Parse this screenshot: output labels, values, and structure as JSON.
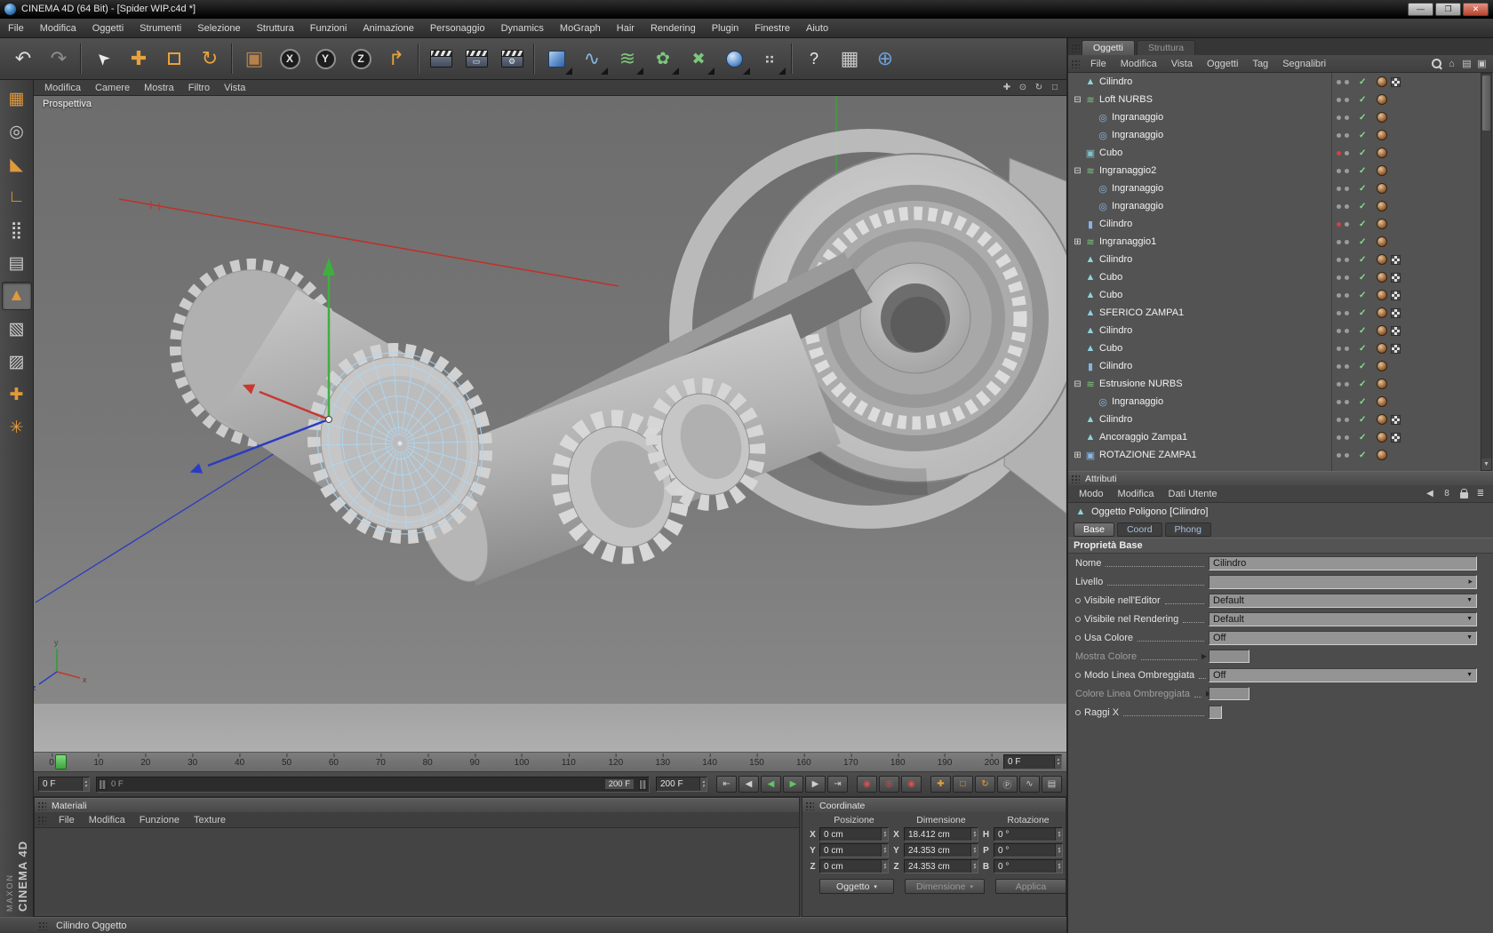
{
  "window": {
    "title": "CINEMA 4D (64 Bit) - [Spider WIP.c4d *]",
    "controls": {
      "minimize": "—",
      "restore": "❐",
      "close": "✕"
    }
  },
  "menu_bar": [
    "File",
    "Modifica",
    "Oggetti",
    "Strumenti",
    "Selezione",
    "Struttura",
    "Funzioni",
    "Animazione",
    "Personaggio",
    "Dynamics",
    "MoGraph",
    "Hair",
    "Rendering",
    "Plugin",
    "Finestre",
    "Aiuto"
  ],
  "toolbar": [
    {
      "name": "undo-button",
      "type": "glyph",
      "glyph": "↶",
      "color": "#dcdcdc"
    },
    {
      "name": "redo-button",
      "type": "glyph",
      "glyph": "↷",
      "color": "#8d8d8d"
    },
    {
      "name": "sep"
    },
    {
      "name": "live-selection-tool",
      "type": "glyph",
      "glyph": "➤",
      "color": "#ececec",
      "rotate": -135,
      "size": 18
    },
    {
      "name": "move-tool",
      "type": "glyph",
      "glyph": "✚",
      "color": "#e8a23c"
    },
    {
      "name": "scale-tool",
      "type": "square"
    },
    {
      "name": "rotate-tool",
      "type": "glyph",
      "glyph": "↻",
      "color": "#e8a23c"
    },
    {
      "name": "sep"
    },
    {
      "name": "coordinate-box-tool",
      "type": "glyph",
      "glyph": "▣",
      "color": "#b5824c"
    },
    {
      "name": "x-axis-lock",
      "type": "xyz",
      "letter": "X"
    },
    {
      "name": "y-axis-lock",
      "type": "xyz",
      "letter": "Y"
    },
    {
      "name": "z-axis-lock",
      "type": "xyz",
      "letter": "Z"
    },
    {
      "name": "coordinate-system-toggle",
      "type": "glyph",
      "glyph": "↱",
      "color": "#e8a23c"
    },
    {
      "name": "sep"
    },
    {
      "name": "render-view-button",
      "type": "clapper",
      "overlay": ""
    },
    {
      "name": "render-picture-viewer-button",
      "type": "clapper",
      "overlay": "▭"
    },
    {
      "name": "render-settings-button",
      "type": "clapper",
      "overlay": "⚙"
    },
    {
      "name": "sep"
    },
    {
      "name": "add-cube-button",
      "type": "cube",
      "dropdown": true
    },
    {
      "name": "add-spline-button",
      "type": "glyph",
      "glyph": "∿",
      "color": "#8ab4e0",
      "dropdown": true
    },
    {
      "name": "add-nurbs-button",
      "type": "glyph",
      "glyph": "≋",
      "color": "#7cc87c",
      "dropdown": true
    },
    {
      "name": "add-modeling-button",
      "type": "glyph",
      "glyph": "✿",
      "color": "#7cc87c",
      "dropdown": true,
      "size": 19
    },
    {
      "name": "add-deformer-button",
      "type": "glyph",
      "glyph": "✖",
      "color": "#7cc87c",
      "dropdown": true,
      "size": 18
    },
    {
      "name": "add-scene-button",
      "type": "sphere",
      "dropdown": true
    },
    {
      "name": "add-particle-button",
      "type": "glyph",
      "glyph": "⠶",
      "color": "#c8c8c8",
      "dropdown": true,
      "size": 18
    },
    {
      "name": "sep"
    },
    {
      "name": "help-button",
      "type": "glyph",
      "glyph": "?",
      "color": "#ececec",
      "size": 18
    },
    {
      "name": "content-browser-button",
      "type": "glyph",
      "glyph": "▦",
      "color": "#c8c8c8"
    },
    {
      "name": "online-updater-button",
      "type": "glyph",
      "glyph": "⊕",
      "color": "#6f9fd8"
    }
  ],
  "left_toolbar": [
    {
      "name": "make-editable-button",
      "glyph": "▦",
      "color": "#e0993c"
    },
    {
      "name": "model-mode-button",
      "glyph": "◎",
      "color": "#c8c8c8"
    },
    {
      "name": "texture-mode-button",
      "glyph": "◣",
      "color": "#e0993c"
    },
    {
      "name": "workplane-mode-button",
      "glyph": "∟",
      "color": "#e0993c"
    },
    {
      "name": "points-mode-button",
      "glyph": "⣿",
      "color": "#d0d0d0"
    },
    {
      "name": "edges-mode-button",
      "glyph": "▤",
      "color": "#d0d0d0"
    },
    {
      "name": "polygons-mode-button",
      "glyph": "▲",
      "color": "#e0993c",
      "active": true
    },
    {
      "name": "object-mode-button",
      "glyph": "▧",
      "color": "#d0d0d0"
    },
    {
      "name": "texture-axis-mode-button",
      "glyph": "▨",
      "color": "#d0d0d0"
    },
    {
      "name": "object-axis-mode-button",
      "glyph": "✚",
      "color": "#e0993c"
    },
    {
      "name": "snap-settings-button",
      "glyph": "✳",
      "color": "#e0993c"
    }
  ],
  "viewport": {
    "label": "Prospettiva",
    "menu": [
      "Modifica",
      "Camere",
      "Mostra",
      "Filtro",
      "Vista"
    ],
    "nav_icons": [
      {
        "name": "pan-view-icon",
        "glyph": "✚"
      },
      {
        "name": "zoom-view-icon",
        "glyph": "⊙"
      },
      {
        "name": "rotate-view-icon",
        "glyph": "↻"
      },
      {
        "name": "toggle-view-icon",
        "glyph": "□"
      }
    ]
  },
  "object_manager": {
    "tabs": [
      {
        "label": "Oggetti",
        "active": true
      },
      {
        "label": "Struttura",
        "active": false
      }
    ],
    "menu": [
      "File",
      "Modifica",
      "Vista",
      "Oggetti",
      "Tag",
      "Segnalibri"
    ],
    "icons": [
      {
        "name": "search-icon",
        "type": "mag"
      },
      {
        "name": "home-icon",
        "glyph": "⌂"
      },
      {
        "name": "layout-icon",
        "glyph": "▤"
      },
      {
        "name": "detach-panel-icon",
        "glyph": "▣"
      }
    ],
    "items": [
      {
        "label": "Cilindro",
        "level": 0,
        "icon": "poly",
        "expand": "",
        "tags": [
          "mat",
          "uvw"
        ],
        "dots": "gray"
      },
      {
        "label": "Loft NURBS",
        "level": 0,
        "icon": "loft",
        "expand": "-",
        "tags": [
          "mat"
        ],
        "dots": "gray"
      },
      {
        "label": "Ingranaggio",
        "level": 1,
        "icon": "spline",
        "expand": "",
        "tags": [
          "mat"
        ],
        "dots": "gray"
      },
      {
        "label": "Ingranaggio",
        "level": 1,
        "icon": "spline",
        "expand": "",
        "tags": [
          "mat"
        ],
        "dots": "gray"
      },
      {
        "label": "Cubo",
        "level": 0,
        "icon": "cube",
        "expand": "",
        "tags": [
          "mat"
        ],
        "dots": "red"
      },
      {
        "label": "Ingranaggio2",
        "level": 0,
        "icon": "loft",
        "expand": "-",
        "tags": [
          "mat"
        ],
        "dots": "gray"
      },
      {
        "label": "Ingranaggio",
        "level": 1,
        "icon": "spline",
        "expand": "",
        "tags": [
          "mat"
        ],
        "dots": "gray"
      },
      {
        "label": "Ingranaggio",
        "level": 1,
        "icon": "spline",
        "expand": "",
        "tags": [
          "mat"
        ],
        "dots": "gray"
      },
      {
        "label": "Cilindro",
        "level": 0,
        "icon": "cyl",
        "expand": "",
        "tags": [
          "mat"
        ],
        "dots": "red"
      },
      {
        "label": "Ingranaggio1",
        "level": 0,
        "icon": "loft",
        "expand": "+",
        "tags": [
          "mat"
        ],
        "dots": "gray"
      },
      {
        "label": "Cilindro",
        "level": 0,
        "icon": "poly",
        "expand": "",
        "tags": [
          "mat",
          "uvw"
        ],
        "dots": "gray"
      },
      {
        "label": "Cubo",
        "level": 0,
        "icon": "poly",
        "expand": "",
        "tags": [
          "mat",
          "uvw"
        ],
        "dots": "gray"
      },
      {
        "label": "Cubo",
        "level": 0,
        "icon": "poly",
        "expand": "",
        "tags": [
          "mat",
          "uvw"
        ],
        "dots": "gray"
      },
      {
        "label": "SFERICO ZAMPA1",
        "level": 0,
        "icon": "poly",
        "expand": "",
        "tags": [
          "mat",
          "uvw"
        ],
        "dots": "gray"
      },
      {
        "label": "Cilindro",
        "level": 0,
        "icon": "poly",
        "expand": "",
        "tags": [
          "mat",
          "uvw"
        ],
        "dots": "gray"
      },
      {
        "label": "Cubo",
        "level": 0,
        "icon": "poly",
        "expand": "",
        "tags": [
          "mat",
          "uvw"
        ],
        "dots": "gray"
      },
      {
        "label": "Cilindro",
        "level": 0,
        "icon": "cyl",
        "expand": "",
        "tags": [
          "mat"
        ],
        "dots": "gray"
      },
      {
        "label": "Estrusione NURBS",
        "level": 0,
        "icon": "extrude",
        "expand": "-",
        "tags": [
          "mat"
        ],
        "dots": "gray"
      },
      {
        "label": "Ingranaggio",
        "level": 1,
        "icon": "spline",
        "expand": "",
        "tags": [
          "mat"
        ],
        "dots": "gray"
      },
      {
        "label": "Cilindro",
        "level": 0,
        "icon": "poly",
        "expand": "",
        "tags": [
          "mat",
          "uvw"
        ],
        "dots": "gray"
      },
      {
        "label": "Ancoraggio Zampa1",
        "level": 0,
        "icon": "poly",
        "expand": "",
        "tags": [
          "mat",
          "uvw"
        ],
        "dots": "gray"
      },
      {
        "label": "ROTAZIONE ZAMPA1",
        "level": 0,
        "icon": "null",
        "expand": "+",
        "tags": [
          "mat"
        ],
        "dots": "gray"
      }
    ]
  },
  "attributes": {
    "header": "Attributi",
    "tabs": [
      "Modo",
      "Modifica",
      "Dati Utente"
    ],
    "icons": [
      {
        "name": "nav-back-icon",
        "glyph": "◀"
      },
      {
        "name": "element-count-badge",
        "glyph": "8"
      },
      {
        "name": "lock-icon",
        "type": "lock"
      },
      {
        "name": "panel-menu-icon",
        "glyph": "≣"
      }
    ],
    "object_title": "Oggetto Poligono [Cilindro]",
    "sub_tabs": [
      {
        "label": "Base",
        "active": true
      },
      {
        "label": "Coord",
        "active": false
      },
      {
        "label": "Phong",
        "active": false
      }
    ],
    "section": "Proprietà Base",
    "rows": [
      {
        "name": "nome",
        "label": "Nome",
        "type": "text",
        "value": "Cilindro"
      },
      {
        "name": "livello",
        "label": "Livello",
        "type": "level",
        "value": ""
      },
      {
        "name": "visibile-editor",
        "label": "Visibile nell'Editor",
        "type": "dropdown",
        "value": "Default",
        "adot": true
      },
      {
        "name": "visibile-rendering",
        "label": "Visibile nel Rendering",
        "type": "dropdown",
        "value": "Default",
        "adot": true
      },
      {
        "name": "usa-colore",
        "label": "Usa Colore",
        "type": "dropdown",
        "value": "Off",
        "adot": true
      },
      {
        "name": "mostra-colore",
        "label": "Mostra Colore",
        "type": "swatch",
        "disabled": true,
        "expander": true
      },
      {
        "name": "modo-linea-ombreggiata",
        "label": "Modo Linea Ombreggiata",
        "type": "dropdown",
        "value": "Off",
        "adot": true
      },
      {
        "name": "colore-linea-ombreggiata",
        "label": "Colore Linea Ombreggiata",
        "type": "swatch",
        "disabled": true,
        "expander": true
      },
      {
        "name": "raggi-x",
        "label": "Raggi X",
        "type": "checkbox",
        "checked": false,
        "adot": true
      }
    ]
  },
  "timeline": {
    "ticks": [
      "0",
      "10",
      "20",
      "30",
      "40",
      "50",
      "60",
      "70",
      "80",
      "90",
      "100",
      "110",
      "120",
      "130",
      "140",
      "150",
      "160",
      "170",
      "180",
      "190",
      "200"
    ],
    "current_frame": "0 F",
    "frame_field": "0 F",
    "range_start": "0 F",
    "range_end": "200 F",
    "end_field": "200 F",
    "transport": [
      {
        "name": "goto-start-button",
        "glyph": "⇤"
      },
      {
        "name": "prev-key-button",
        "glyph": "◀"
      },
      {
        "name": "play-backward-button",
        "glyph": "◀",
        "color": "#62c462"
      },
      {
        "name": "play-forward-button",
        "glyph": "▶",
        "color": "#62c462"
      },
      {
        "name": "next-key-button",
        "glyph": "▶"
      },
      {
        "name": "goto-end-button",
        "glyph": "⇥"
      }
    ],
    "record_buttons": [
      {
        "name": "record-keyframe-button",
        "glyph": "◉",
        "color": "#d65050"
      },
      {
        "name": "autokey-button",
        "glyph": "◎",
        "color": "#d65050"
      },
      {
        "name": "keyframe-selection-button",
        "glyph": "◉",
        "color": "#d65050"
      }
    ],
    "key_toggles": [
      {
        "name": "record-position-toggle",
        "glyph": "✚",
        "color": "#e8a23c"
      },
      {
        "name": "record-scale-toggle",
        "glyph": "□",
        "color": "#e8a23c"
      },
      {
        "name": "record-rotation-toggle",
        "glyph": "↻",
        "color": "#e8a23c"
      },
      {
        "name": "record-parameter-toggle",
        "glyph": "Ⓟ",
        "color": "#c8c8c8"
      },
      {
        "name": "record-pla-toggle",
        "glyph": "∿",
        "color": "#c8c8c8"
      },
      {
        "name": "timeline-options-button",
        "glyph": "▤",
        "color": "#c8c8c8"
      }
    ]
  },
  "materials": {
    "header": "Materiali",
    "menu": [
      "File",
      "Modifica",
      "Funzione",
      "Texture"
    ]
  },
  "coordinates": {
    "header": "Coordinate",
    "columns": [
      "Posizione",
      "Dimensione",
      "Rotazione"
    ],
    "rows": [
      {
        "a": "X",
        "pos": "0 cm",
        "b": "X",
        "dim": "18.412 cm",
        "c": "H",
        "rot": "0 °"
      },
      {
        "a": "Y",
        "pos": "0 cm",
        "b": "Y",
        "dim": "24.353 cm",
        "c": "P",
        "rot": "0 °"
      },
      {
        "a": "Z",
        "pos": "0 cm",
        "b": "Z",
        "dim": "24.353 cm",
        "c": "B",
        "rot": "0 °"
      }
    ],
    "actions": [
      {
        "label": "Oggetto",
        "type": "dropdown"
      },
      {
        "label": "Dimensione",
        "type": "dropdown",
        "disabled": true
      },
      {
        "label": "Applica",
        "type": "button",
        "disabled": true
      }
    ]
  },
  "status_bar": {
    "text": "Cilindro Oggetto"
  },
  "brand": {
    "maxon": "MAXON",
    "product": "CINEMA 4D"
  }
}
